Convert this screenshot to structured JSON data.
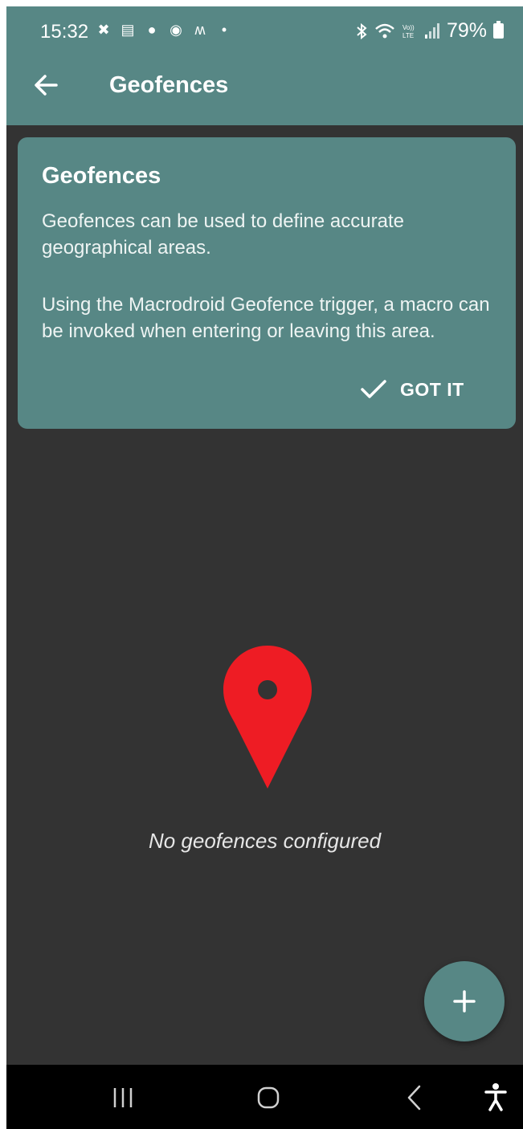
{
  "status_bar": {
    "time": "15:32",
    "notification_icons": [
      "halifax-icon",
      "app-icon",
      "moneybox-icon",
      "amex-icon",
      "monzo-icon",
      "dot-icon"
    ],
    "battery_percent": "79%",
    "status_icons": [
      "bluetooth-icon",
      "wifi-icon",
      "volte-icon",
      "signal-icon",
      "battery-icon"
    ]
  },
  "toolbar": {
    "title": "Geofences"
  },
  "info_card": {
    "title": "Geofences",
    "paragraph1": "Geofences can be used to define accurate geographical areas.",
    "paragraph2": "Using the Macrodroid Geofence trigger, a macro can be invoked when entering or leaving this area.",
    "button_label": "GOT IT"
  },
  "empty_state": {
    "message": "No geofences configured"
  },
  "colors": {
    "accent": "#578785",
    "background": "#333333",
    "pin": "#ee1c24"
  }
}
